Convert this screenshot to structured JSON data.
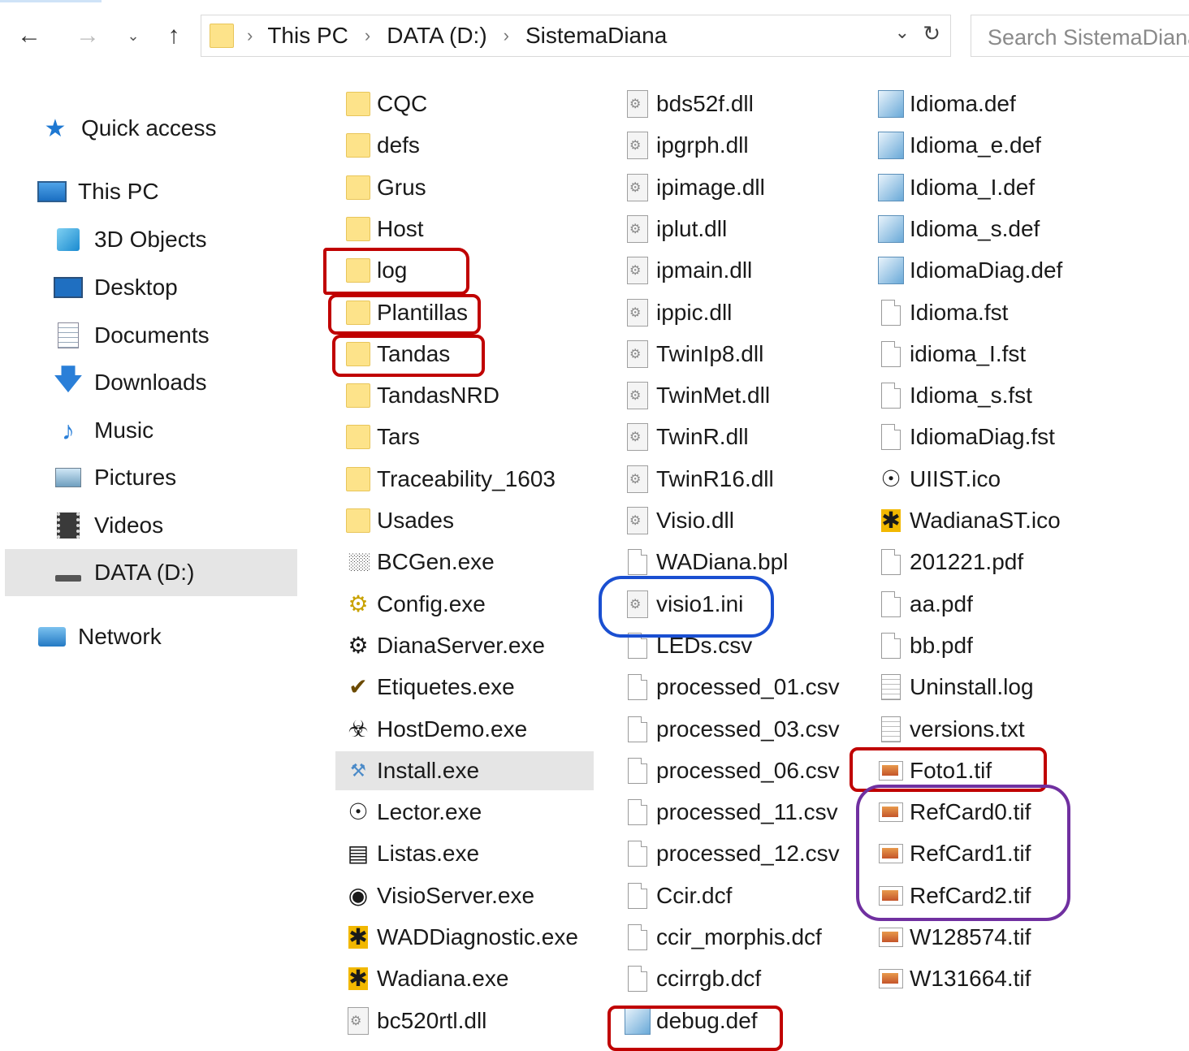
{
  "address_bar": {
    "crumbs": [
      "This PC",
      "DATA (D:)",
      "SistemaDiana"
    ],
    "search_placeholder": "Search SistemaDiana"
  },
  "sidebar": {
    "items": [
      {
        "label": "Quick access",
        "icon": "star-icon"
      },
      {
        "label": "This PC",
        "icon": "computer-icon"
      },
      {
        "label": "3D Objects",
        "icon": "cube-icon"
      },
      {
        "label": "Desktop",
        "icon": "desktop-icon"
      },
      {
        "label": "Documents",
        "icon": "documents-icon"
      },
      {
        "label": "Downloads",
        "icon": "download-arrow-icon"
      },
      {
        "label": "Music",
        "icon": "music-note-icon"
      },
      {
        "label": "Pictures",
        "icon": "pictures-icon"
      },
      {
        "label": "Videos",
        "icon": "film-icon"
      },
      {
        "label": "DATA (D:)",
        "icon": "drive-icon"
      },
      {
        "label": "Network",
        "icon": "network-icon"
      }
    ],
    "selected": "DATA (D:)"
  },
  "files": {
    "col1": [
      {
        "name": "CQC",
        "type": "folder"
      },
      {
        "name": "defs",
        "type": "folder"
      },
      {
        "name": "Grus",
        "type": "folder"
      },
      {
        "name": "Host",
        "type": "folder"
      },
      {
        "name": "log",
        "type": "folder"
      },
      {
        "name": "Plantillas",
        "type": "folder"
      },
      {
        "name": "Tandas",
        "type": "folder"
      },
      {
        "name": "TandasNRD",
        "type": "folder"
      },
      {
        "name": "Tars",
        "type": "folder"
      },
      {
        "name": "Traceability_1603",
        "type": "folder"
      },
      {
        "name": "Usades",
        "type": "folder"
      },
      {
        "name": "BCGen.exe",
        "type": "exe"
      },
      {
        "name": "Config.exe",
        "type": "exe"
      },
      {
        "name": "DianaServer.exe",
        "type": "exe"
      },
      {
        "name": "Etiquetes.exe",
        "type": "exe"
      },
      {
        "name": "HostDemo.exe",
        "type": "exe"
      },
      {
        "name": "Install.exe",
        "type": "exe"
      },
      {
        "name": "Lector.exe",
        "type": "exe"
      },
      {
        "name": "Listas.exe",
        "type": "exe"
      },
      {
        "name": "VisioServer.exe",
        "type": "exe"
      },
      {
        "name": "WADDiagnostic.exe",
        "type": "exe"
      },
      {
        "name": "Wadiana.exe",
        "type": "exe"
      },
      {
        "name": "bc520rtl.dll",
        "type": "dll"
      }
    ],
    "col2": [
      {
        "name": "bds52f.dll",
        "type": "dll"
      },
      {
        "name": "ipgrph.dll",
        "type": "dll"
      },
      {
        "name": "ipimage.dll",
        "type": "dll"
      },
      {
        "name": "iplut.dll",
        "type": "dll"
      },
      {
        "name": "ipmain.dll",
        "type": "dll"
      },
      {
        "name": "ippic.dll",
        "type": "dll"
      },
      {
        "name": "TwinIp8.dll",
        "type": "dll"
      },
      {
        "name": "TwinMet.dll",
        "type": "dll"
      },
      {
        "name": "TwinR.dll",
        "type": "dll"
      },
      {
        "name": "TwinR16.dll",
        "type": "dll"
      },
      {
        "name": "Visio.dll",
        "type": "dll"
      },
      {
        "name": "WADiana.bpl",
        "type": "file"
      },
      {
        "name": "visio1.ini",
        "type": "ini"
      },
      {
        "name": "LEDs.csv",
        "type": "file"
      },
      {
        "name": "processed_01.csv",
        "type": "file"
      },
      {
        "name": "processed_03.csv",
        "type": "file"
      },
      {
        "name": "processed_06.csv",
        "type": "file"
      },
      {
        "name": "processed_11.csv",
        "type": "file"
      },
      {
        "name": "processed_12.csv",
        "type": "file"
      },
      {
        "name": "Ccir.dcf",
        "type": "file"
      },
      {
        "name": "ccir_morphis.dcf",
        "type": "file"
      },
      {
        "name": "ccirrgb.dcf",
        "type": "file"
      },
      {
        "name": "debug.def",
        "type": "def"
      }
    ],
    "col3": [
      {
        "name": "Idioma.def",
        "type": "def"
      },
      {
        "name": "Idioma_e.def",
        "type": "def"
      },
      {
        "name": "Idioma_I.def",
        "type": "def"
      },
      {
        "name": "Idioma_s.def",
        "type": "def"
      },
      {
        "name": "IdiomaDiag.def",
        "type": "def"
      },
      {
        "name": "Idioma.fst",
        "type": "file"
      },
      {
        "name": "idioma_I.fst",
        "type": "file"
      },
      {
        "name": "Idioma_s.fst",
        "type": "file"
      },
      {
        "name": "IdiomaDiag.fst",
        "type": "file"
      },
      {
        "name": "UIIST.ico",
        "type": "ico"
      },
      {
        "name": "WadianaST.ico",
        "type": "ico"
      },
      {
        "name": "201221.pdf",
        "type": "file"
      },
      {
        "name": "aa.pdf",
        "type": "file"
      },
      {
        "name": "bb.pdf",
        "type": "file"
      },
      {
        "name": "Uninstall.log",
        "type": "txt"
      },
      {
        "name": "versions.txt",
        "type": "txt"
      },
      {
        "name": "Foto1.tif",
        "type": "tif"
      },
      {
        "name": "RefCard0.tif",
        "type": "tif"
      },
      {
        "name": "RefCard1.tif",
        "type": "tif"
      },
      {
        "name": "RefCard2.tif",
        "type": "tif"
      },
      {
        "name": "W128574.tif",
        "type": "tif"
      },
      {
        "name": "W131664.tif",
        "type": "tif"
      }
    ],
    "selected": "Install.exe"
  },
  "annotations": {
    "red": "#c00000",
    "blue": "#1a4fd1",
    "purple": "#7030a0",
    "red_targets": [
      "log",
      "Plantillas",
      "Tandas",
      "Foto1.tif",
      "debug.def"
    ],
    "blue_targets": [
      "visio1.ini"
    ],
    "purple_targets": [
      "RefCard0.tif",
      "RefCard1.tif",
      "RefCard2.tif"
    ]
  }
}
